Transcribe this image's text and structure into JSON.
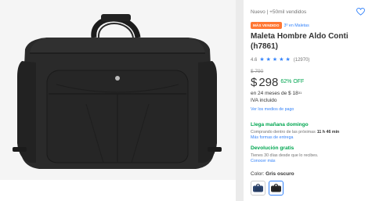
{
  "product": {
    "condition": "Nuevo  |  +50mil vendidos",
    "badge_best_seller": "MÁS VENDIDO",
    "badge_rank": "3º en Maletas",
    "title": "Maleta Hombre Aldo Conti (h7861)",
    "rating": {
      "value": "4.6",
      "stars": 5,
      "count": "(12970)"
    },
    "price": {
      "old": "$ 790",
      "currency": "$",
      "current": "298",
      "discount": "62% OFF"
    },
    "installments": {
      "text": "en 24 meses de $ 18",
      "cents": "31"
    },
    "iva": "IVA incluido",
    "payments_link": "Ver los medios de pago",
    "delivery": {
      "title": "Llega mañana domingo",
      "subtitle": "Comprando dentro de las próximas",
      "countdown": "11 h 46 min",
      "link": "Más formas de entrega"
    },
    "returns": {
      "title": "Devolución gratis",
      "subtitle": "Tienes 30 días desde que lo recibes.",
      "link": "Conocer más"
    },
    "color": {
      "label": "Color:",
      "selected": "Gris oscuro",
      "options": [
        "blue-navy",
        "gris-oscuro"
      ]
    }
  },
  "colors": {
    "accent": "#3483fa",
    "green": "#00a650",
    "orange_badge": "#ff7733"
  },
  "icons": {
    "favorite": "heart-outline-icon",
    "star": "star-icon"
  }
}
